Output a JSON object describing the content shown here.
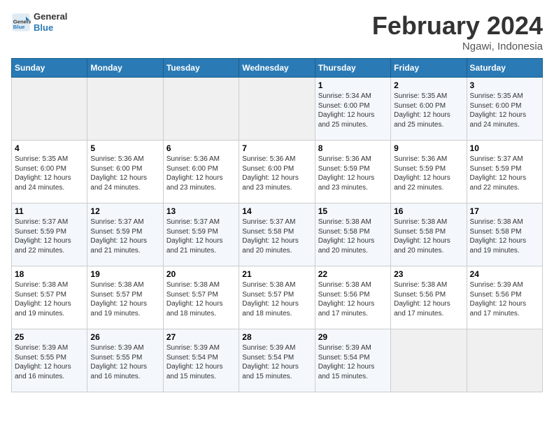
{
  "header": {
    "logo_line1": "General",
    "logo_line2": "Blue",
    "month_title": "February 2024",
    "location": "Ngawi, Indonesia"
  },
  "days_of_week": [
    "Sunday",
    "Monday",
    "Tuesday",
    "Wednesday",
    "Thursday",
    "Friday",
    "Saturday"
  ],
  "weeks": [
    [
      {
        "day": "",
        "info": ""
      },
      {
        "day": "",
        "info": ""
      },
      {
        "day": "",
        "info": ""
      },
      {
        "day": "",
        "info": ""
      },
      {
        "day": "1",
        "info": "Sunrise: 5:34 AM\nSunset: 6:00 PM\nDaylight: 12 hours\nand 25 minutes."
      },
      {
        "day": "2",
        "info": "Sunrise: 5:35 AM\nSunset: 6:00 PM\nDaylight: 12 hours\nand 25 minutes."
      },
      {
        "day": "3",
        "info": "Sunrise: 5:35 AM\nSunset: 6:00 PM\nDaylight: 12 hours\nand 24 minutes."
      }
    ],
    [
      {
        "day": "4",
        "info": "Sunrise: 5:35 AM\nSunset: 6:00 PM\nDaylight: 12 hours\nand 24 minutes."
      },
      {
        "day": "5",
        "info": "Sunrise: 5:36 AM\nSunset: 6:00 PM\nDaylight: 12 hours\nand 24 minutes."
      },
      {
        "day": "6",
        "info": "Sunrise: 5:36 AM\nSunset: 6:00 PM\nDaylight: 12 hours\nand 23 minutes."
      },
      {
        "day": "7",
        "info": "Sunrise: 5:36 AM\nSunset: 6:00 PM\nDaylight: 12 hours\nand 23 minutes."
      },
      {
        "day": "8",
        "info": "Sunrise: 5:36 AM\nSunset: 5:59 PM\nDaylight: 12 hours\nand 23 minutes."
      },
      {
        "day": "9",
        "info": "Sunrise: 5:36 AM\nSunset: 5:59 PM\nDaylight: 12 hours\nand 22 minutes."
      },
      {
        "day": "10",
        "info": "Sunrise: 5:37 AM\nSunset: 5:59 PM\nDaylight: 12 hours\nand 22 minutes."
      }
    ],
    [
      {
        "day": "11",
        "info": "Sunrise: 5:37 AM\nSunset: 5:59 PM\nDaylight: 12 hours\nand 22 minutes."
      },
      {
        "day": "12",
        "info": "Sunrise: 5:37 AM\nSunset: 5:59 PM\nDaylight: 12 hours\nand 21 minutes."
      },
      {
        "day": "13",
        "info": "Sunrise: 5:37 AM\nSunset: 5:59 PM\nDaylight: 12 hours\nand 21 minutes."
      },
      {
        "day": "14",
        "info": "Sunrise: 5:37 AM\nSunset: 5:58 PM\nDaylight: 12 hours\nand 20 minutes."
      },
      {
        "day": "15",
        "info": "Sunrise: 5:38 AM\nSunset: 5:58 PM\nDaylight: 12 hours\nand 20 minutes."
      },
      {
        "day": "16",
        "info": "Sunrise: 5:38 AM\nSunset: 5:58 PM\nDaylight: 12 hours\nand 20 minutes."
      },
      {
        "day": "17",
        "info": "Sunrise: 5:38 AM\nSunset: 5:58 PM\nDaylight: 12 hours\nand 19 minutes."
      }
    ],
    [
      {
        "day": "18",
        "info": "Sunrise: 5:38 AM\nSunset: 5:57 PM\nDaylight: 12 hours\nand 19 minutes."
      },
      {
        "day": "19",
        "info": "Sunrise: 5:38 AM\nSunset: 5:57 PM\nDaylight: 12 hours\nand 19 minutes."
      },
      {
        "day": "20",
        "info": "Sunrise: 5:38 AM\nSunset: 5:57 PM\nDaylight: 12 hours\nand 18 minutes."
      },
      {
        "day": "21",
        "info": "Sunrise: 5:38 AM\nSunset: 5:57 PM\nDaylight: 12 hours\nand 18 minutes."
      },
      {
        "day": "22",
        "info": "Sunrise: 5:38 AM\nSunset: 5:56 PM\nDaylight: 12 hours\nand 17 minutes."
      },
      {
        "day": "23",
        "info": "Sunrise: 5:38 AM\nSunset: 5:56 PM\nDaylight: 12 hours\nand 17 minutes."
      },
      {
        "day": "24",
        "info": "Sunrise: 5:39 AM\nSunset: 5:56 PM\nDaylight: 12 hours\nand 17 minutes."
      }
    ],
    [
      {
        "day": "25",
        "info": "Sunrise: 5:39 AM\nSunset: 5:55 PM\nDaylight: 12 hours\nand 16 minutes."
      },
      {
        "day": "26",
        "info": "Sunrise: 5:39 AM\nSunset: 5:55 PM\nDaylight: 12 hours\nand 16 minutes."
      },
      {
        "day": "27",
        "info": "Sunrise: 5:39 AM\nSunset: 5:54 PM\nDaylight: 12 hours\nand 15 minutes."
      },
      {
        "day": "28",
        "info": "Sunrise: 5:39 AM\nSunset: 5:54 PM\nDaylight: 12 hours\nand 15 minutes."
      },
      {
        "day": "29",
        "info": "Sunrise: 5:39 AM\nSunset: 5:54 PM\nDaylight: 12 hours\nand 15 minutes."
      },
      {
        "day": "",
        "info": ""
      },
      {
        "day": "",
        "info": ""
      }
    ]
  ]
}
